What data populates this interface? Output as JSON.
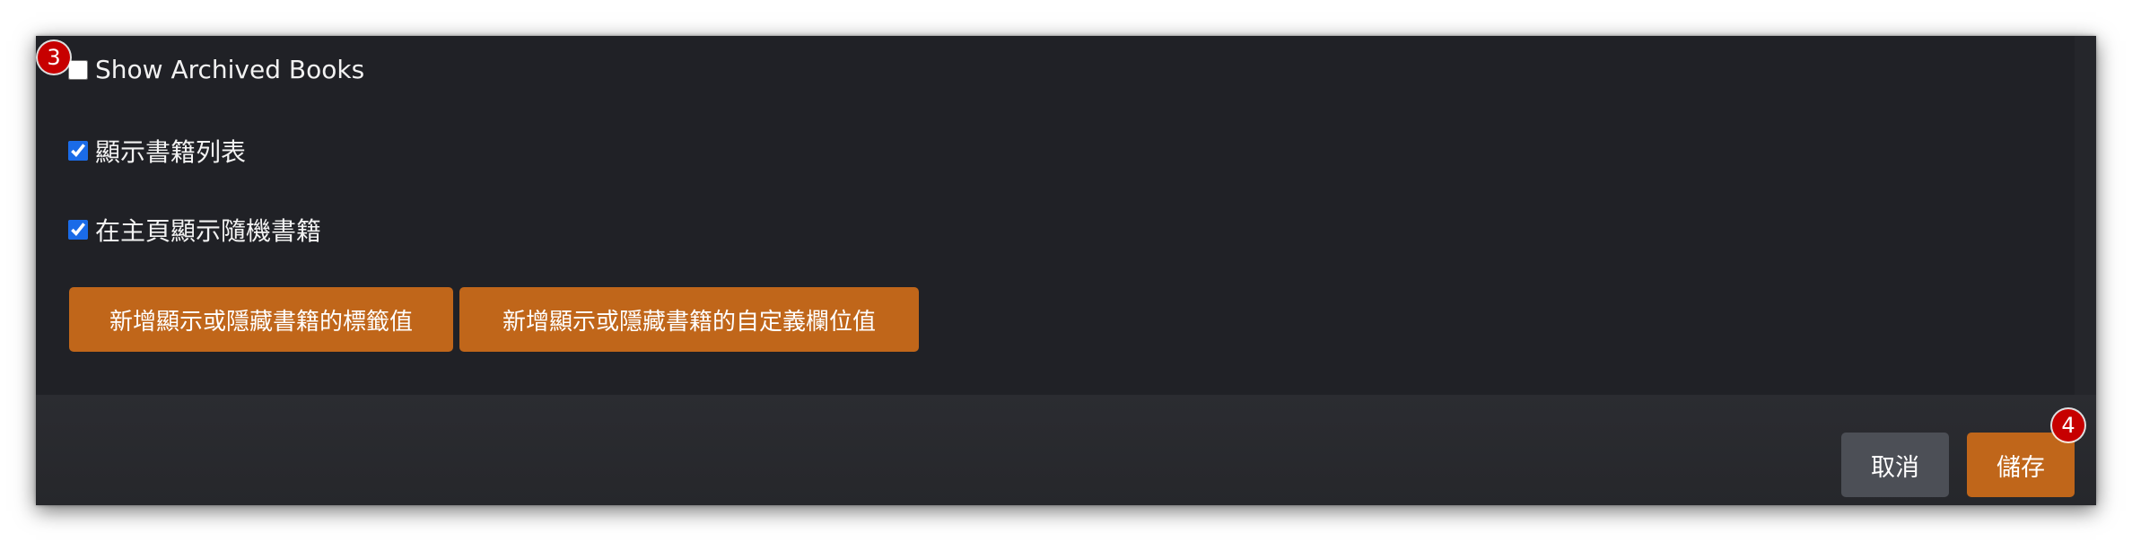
{
  "settings": {
    "show_archived_books": {
      "label": "Show Archived Books",
      "checked": false
    },
    "show_books_list": {
      "label": "顯示書籍列表",
      "checked": true
    },
    "show_random_books": {
      "label": "在主頁顯示隨機書籍",
      "checked": true
    }
  },
  "actions": {
    "tags_button": "新增顯示或隱藏書籍的標籤值",
    "custom_column_button": "新增顯示或隱藏書籍的自定義欄位值"
  },
  "footer": {
    "cancel_label": "取消",
    "save_label": "儲存"
  },
  "annotations": {
    "badge_3": "3",
    "badge_4": "4"
  },
  "colors": {
    "accent_orange": "#c0661a",
    "checkbox_blue": "#1a6be8",
    "badge_red": "#c70000",
    "background": "#202126"
  }
}
